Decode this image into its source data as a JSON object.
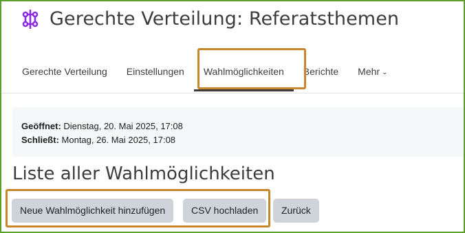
{
  "header": {
    "title": "Gerechte Verteilung: Referatsthemen",
    "icon": "distribution-icon",
    "icon_color": "#8a2be2"
  },
  "tabs": [
    {
      "label": "Gerechte Verteilung",
      "active": false
    },
    {
      "label": "Einstellungen",
      "active": false
    },
    {
      "label": "Wahlmöglichkeiten",
      "active": true
    },
    {
      "label": "Berichte",
      "active": false
    },
    {
      "label": "Mehr",
      "active": false,
      "icon": "chevron-down-icon"
    }
  ],
  "dates": {
    "opened_label": "Geöffnet:",
    "opened_value": "Dienstag, 20. Mai 2025, 17:08",
    "closes_label": "Schließt:",
    "closes_value": "Montag, 26. Mai 2025, 17:08"
  },
  "section": {
    "heading": "Liste aller Wahlmöglichkeiten"
  },
  "buttons": {
    "add_choice": "Neue Wahlmöglichkeit hinzufügen",
    "csv_upload": "CSV hochladen",
    "back": "Zurück"
  },
  "colors": {
    "frame_border": "#5aa02c",
    "highlight": "#c8862a",
    "button_bg": "#ced4da"
  }
}
